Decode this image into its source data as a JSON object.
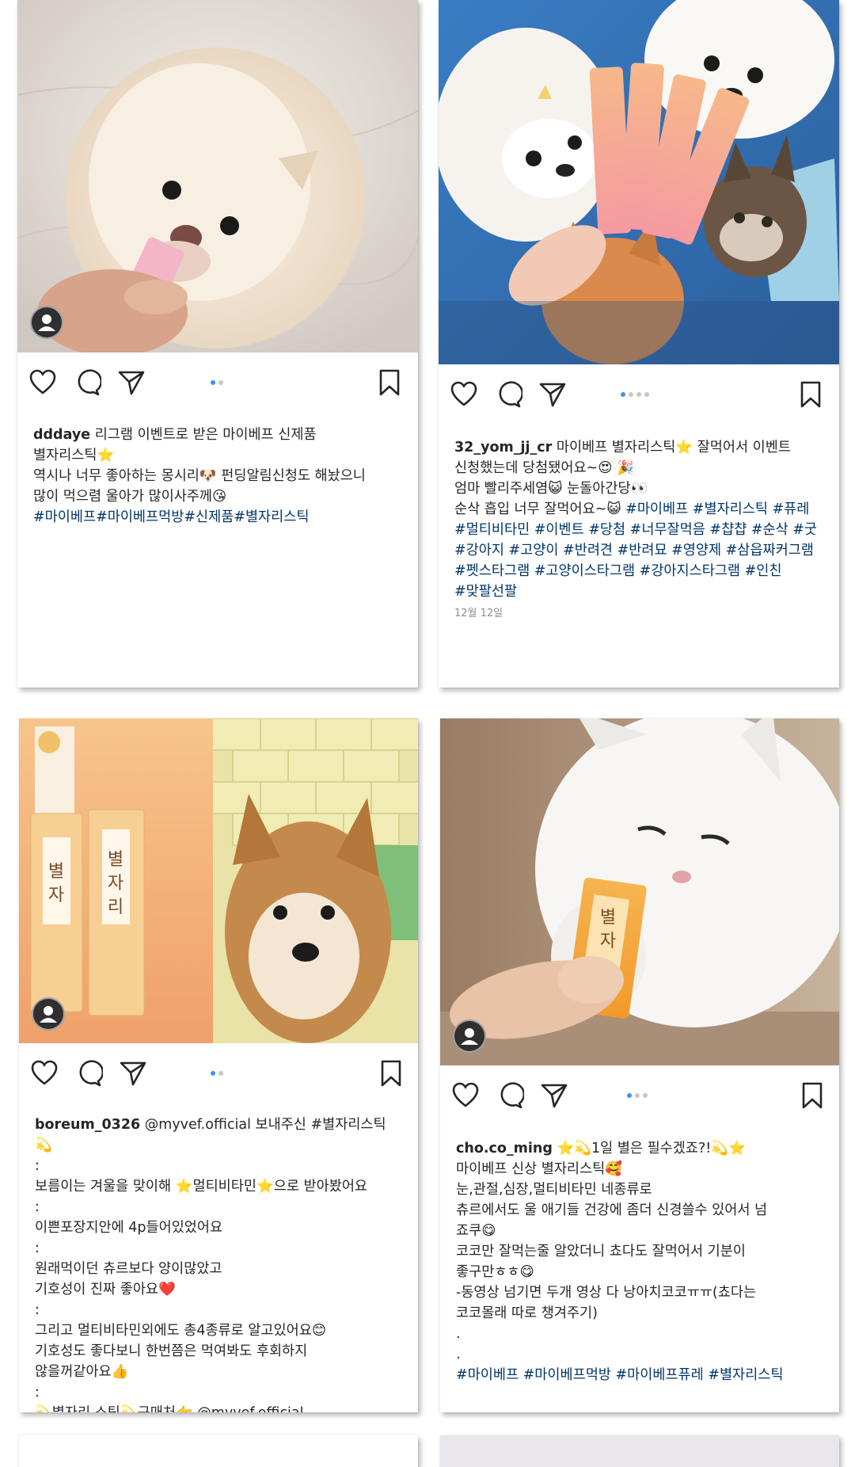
{
  "posts": [
    {
      "username": "dddaye",
      "caption": " 리그램 이벤트로 받은 마이베프 신제품\n별자리스틱⭐\n역시나 너무 좋아하는 몽시리🐶 펀딩알림신청도 해놨으니\n많이 먹으렴 울아가 많이사주께😘",
      "hashtags": "#마이베프#마이베프먹방#신제품#별자리스틱",
      "date": "",
      "carousel_dots": 2
    },
    {
      "username": "32_yom_jj_cr",
      "caption": " 마이베프 별자리스틱⭐ 잘먹어서 이벤트\n신청했는데 당첨됐어요~😍 🎉\n엄마 빨리주세염😺 눈돌아간당👀\n순삭 흡입 너무 잘먹어요~😺 ",
      "hashtags": "#마이베프 #별자리스틱 #퓨레\n#멀티비타민 #이벤트 #당첨 #너무잘먹음 #챱챱 #순삭 #굿\n#강아지 #고양이 #반려견 #반려묘 #영양제 #삼읍짜커그램\n#펫스타그램 #고양이스타그램 #강아지스타그램 #인친\n#맞팔선팔",
      "date": "12월 12일",
      "carousel_dots": 4
    },
    {
      "username": "boreum_0326",
      "caption": " @myvef.official 보내주신 #별자리스틱 💫\n:\n보름이는 겨울을 맞이해 ⭐멀티비타민⭐으로 받아봤어요\n:\n이쁜포장지안에 4p들어있었어요\n:\n원래먹이던 츄르보다 양이많았고\n기호성이 진짜 좋아요❤️\n:\n그리고 멀티비타민외에도 총4종류로 알고있어요😊\n기호성도 좋다보니 한번쯤은 먹여봐도 후회하지\n않을꺼같아요👍\n:\n💫별자리 스틱💫구매처👉 @myvef.official",
      "hashtags": "",
      "date": "",
      "carousel_dots": 2
    },
    {
      "username": "cho.co_ming",
      "caption": " ⭐💫1일 별은 필수겠죠?!💫⭐\n마이베프 신상 별자리스틱🥰\n눈,관절,심장,멀티비타민 네종류로\n츄르에서도 울 애기들 건강에 좀더 신경쓸수 있어서 넘\n죠쿠😋\n코코만 잘먹는줄 알았더니 쵸다도 잘먹어서 기분이\n좋구만ㅎㅎ😋\n-동영상 넘기면 두개 영상 다 낭아치코코ㅠㅠ(쵸다는\n코코몰래 따로 챙겨주기)\n.\n.\n",
      "hashtags": "#마이베프 #마이베프먹방 #마이베프퓨레 #별자리스틱",
      "date": "",
      "carousel_dots": 3
    }
  ],
  "icons": [
    "heart-icon",
    "comment-icon",
    "share-icon",
    "bookmark-icon",
    "user-icon"
  ],
  "colors": {
    "hashtag": "#003569",
    "dot_active": "#3897f0",
    "dot_inactive": "#c7c7c7"
  }
}
